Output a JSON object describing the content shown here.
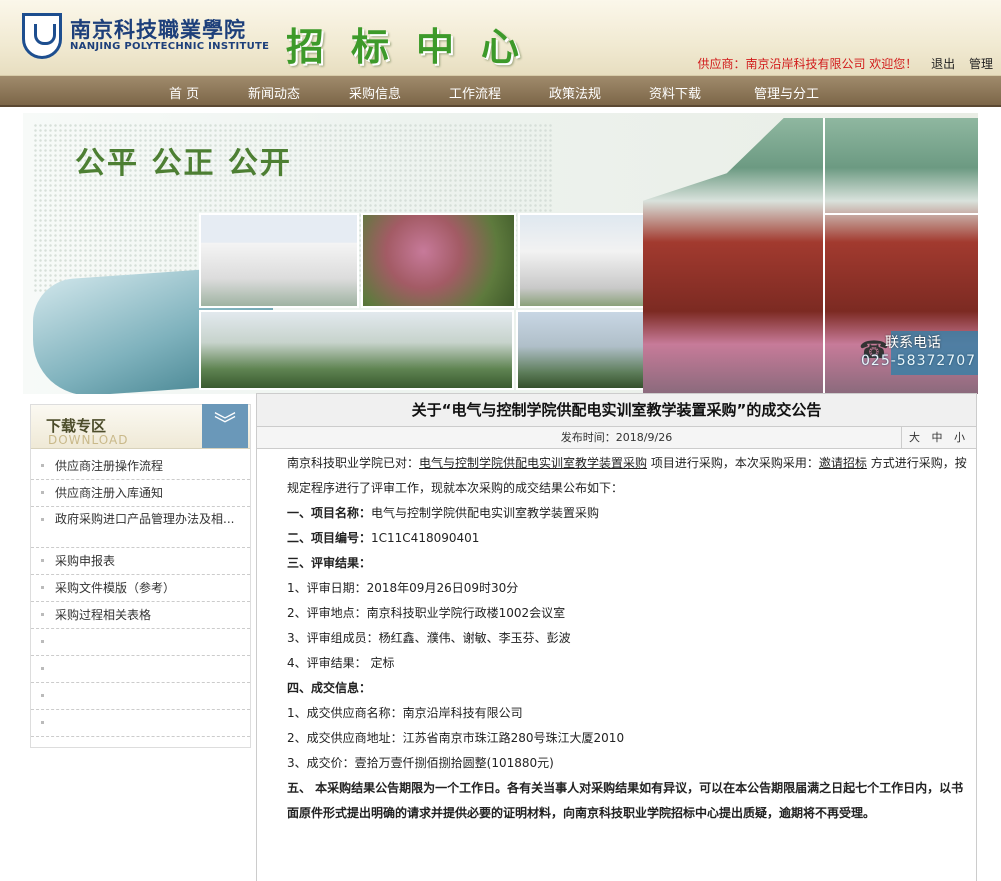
{
  "header": {
    "logo_cn": "南京科技職業學院",
    "logo_en": "NANJING POLYTECHNIC INSTITUTE",
    "site_title": "招标中心",
    "user_text": "供应商：南京沿岸科技有限公司 欢迎您！",
    "logout": "退出",
    "manage": "管理"
  },
  "nav": [
    "首 页",
    "新闻动态",
    "采购信息",
    "工作流程",
    "政策法规",
    "资料下载",
    "管理与分工"
  ],
  "banner": {
    "slogan": "公平  公正  公开",
    "phone_label": "联系电话",
    "phone_number": "025-58372707"
  },
  "sidebar": {
    "title": "下载专区",
    "subtitle": "DOWNLOAD",
    "items": [
      "供应商注册操作流程",
      "供应商注册入库通知",
      "政府采购进口产品管理办法及相...",
      "采购申报表",
      "采购文件模版（参考）",
      "采购过程相关表格",
      "",
      "",
      "",
      ""
    ]
  },
  "article": {
    "title": "关于“电气与控制学院供配电实训室教学装置采购”的成交公告",
    "publish_label": "发布时间：",
    "publish_date": "2018/9/26",
    "font_sizes": "大 中 小",
    "intro_pre": "南京科技职业学院已对：",
    "intro_project": "电气与控制学院供配电实训室教学装置采购",
    "intro_mid": "项目进行采购，本次采购采用：",
    "intro_method": "邀请招标",
    "intro_post": "方式进行采购，按规定程序进行了评审工作，现就本次采购的成交结果公布如下：",
    "s1_label": "一、项目名称：",
    "s1_value": "电气与控制学院供配电实训室教学装置采购",
    "s2_label": "二、项目编号：",
    "s2_value": "1C11C418090401",
    "s3_label": "三、评审结果：",
    "s3_items": [
      "1、评审日期：2018年09月26日09时30分",
      "2、评审地点：南京科技职业学院行政楼1002会议室",
      "3、评审组成员：杨红鑫、濮伟、谢敏、李玉芬、彭波",
      "4、评审结果：  定标"
    ],
    "s4_label": "四、成交信息：",
    "s4_items": [
      "1、成交供应商名称：南京沿岸科技有限公司",
      "2、成交供应商地址：江苏省南京市珠江路280号珠江大厦2010",
      "3、成交价：壹拾万壹仟捌佰捌拾圆整(101880元)"
    ],
    "s5_text": "五、  本采购结果公告期限为一个工作日。各有关当事人对采购结果如有异议，可以在本公告期限届满之日起七个工作日内，以书面原件形式提出明确的请求并提供必要的证明材料，向南京科技职业学院招标中心提出质疑，逾期将不再受理。"
  },
  "colors": {
    "nav_bg": "#7c6648",
    "title_green": "#3d9a2a",
    "supplier_red": "#d11b1b",
    "download_blue": "#6a98b9"
  }
}
